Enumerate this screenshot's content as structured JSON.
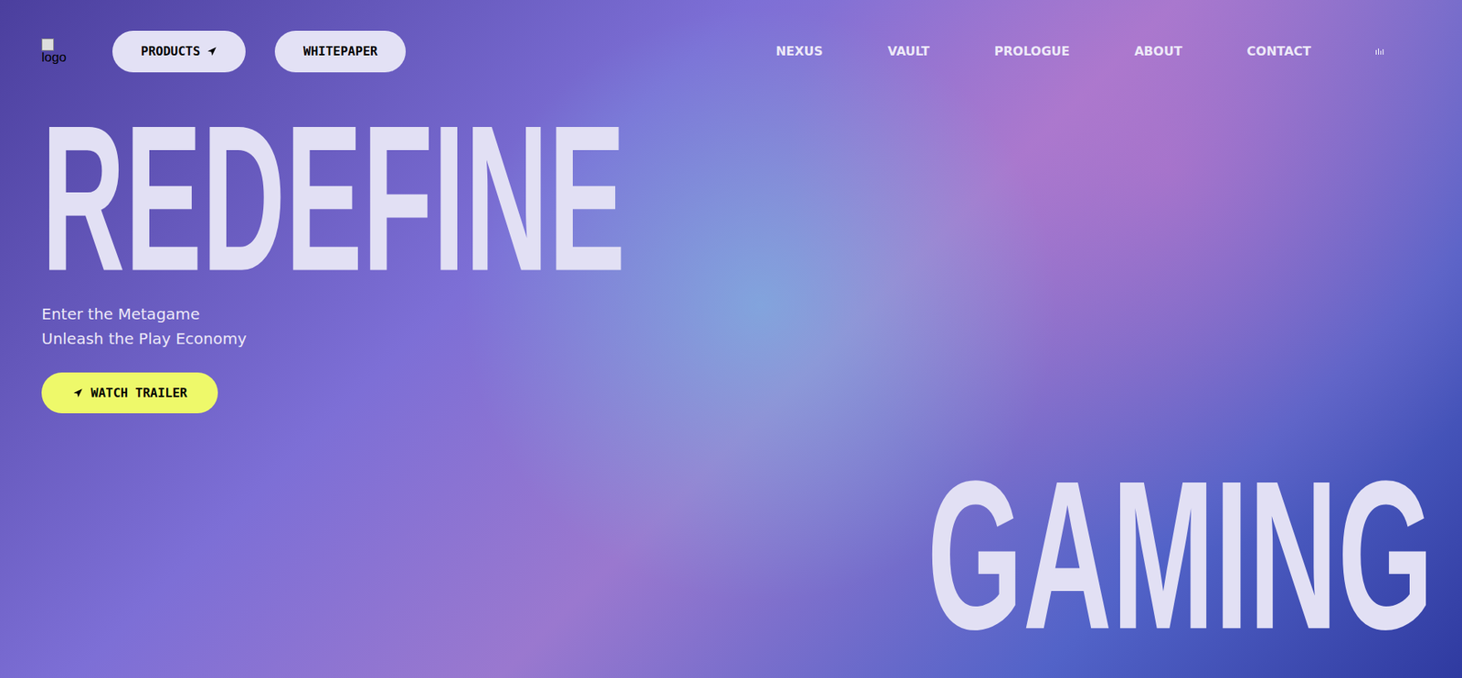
{
  "logo": {
    "alt": "logo"
  },
  "header_buttons": [
    {
      "label": "PRODUCTS",
      "kind": "menu"
    },
    {
      "label": "WHITEPAPER",
      "kind": "plain"
    }
  ],
  "nav_links": [
    "NEXUS",
    "VAULT",
    "PROLOGUE",
    "ABOUT",
    "CONTACT"
  ],
  "hero": {
    "title_top": "REDEFINE",
    "subtitle": [
      "Enter the Metagame",
      "Unleash the Play Economy"
    ],
    "cta": "WATCH TRAILER",
    "title_bottom": "GAMING"
  }
}
